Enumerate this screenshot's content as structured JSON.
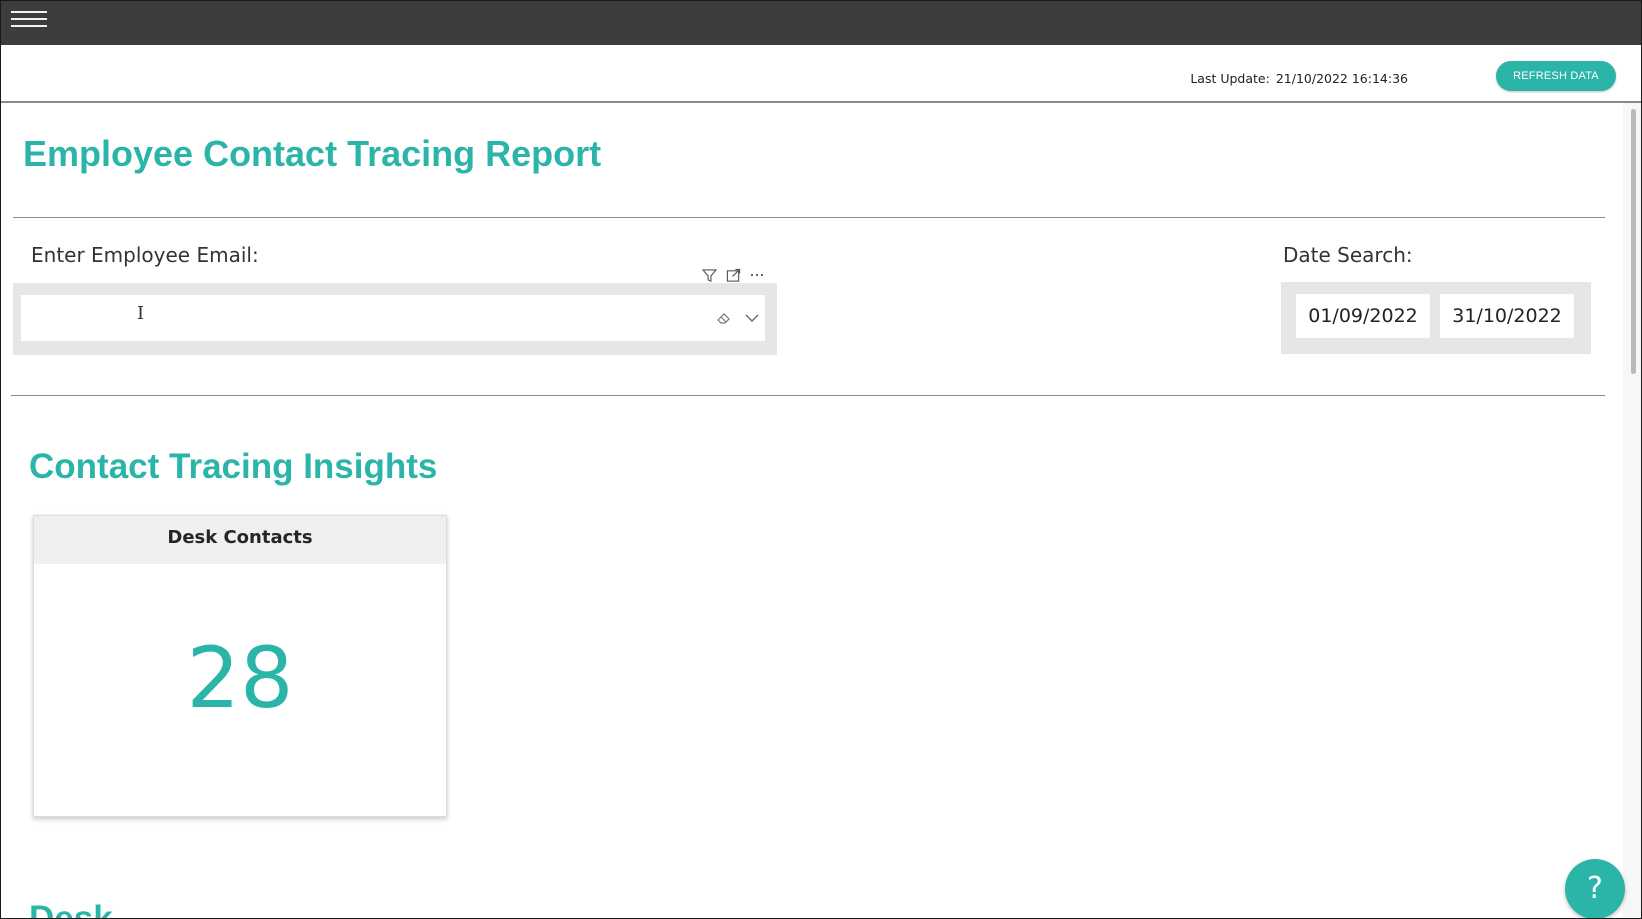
{
  "topbar": {
    "menu_icon": "hamburger-icon"
  },
  "header": {
    "last_update_label": "Last Update:",
    "last_update_value": "21/10/2022 16:14:36",
    "refresh_label": "REFRESH DATA"
  },
  "report": {
    "title": "Employee Contact Tracing Report"
  },
  "email_filter": {
    "label": "Enter Employee Email:",
    "value": "",
    "placeholder": "",
    "tool_icons": [
      "filter-icon",
      "focus-mode-icon",
      "more-options-icon"
    ],
    "clear_icon": "eraser-icon",
    "dropdown_icon": "chevron-down-icon"
  },
  "date_filter": {
    "label": "Date Search:",
    "start": "01/09/2022",
    "end": "31/10/2022"
  },
  "insights": {
    "title": "Contact Tracing Insights",
    "card": {
      "title": "Desk Contacts",
      "value": "28"
    }
  },
  "next_section": {
    "title_partial": "Desk"
  },
  "help": {
    "label": "?"
  },
  "colors": {
    "accent": "#2bb5a8",
    "topbar": "#3d3d3d",
    "slicer_bg": "#e6e6e6"
  }
}
